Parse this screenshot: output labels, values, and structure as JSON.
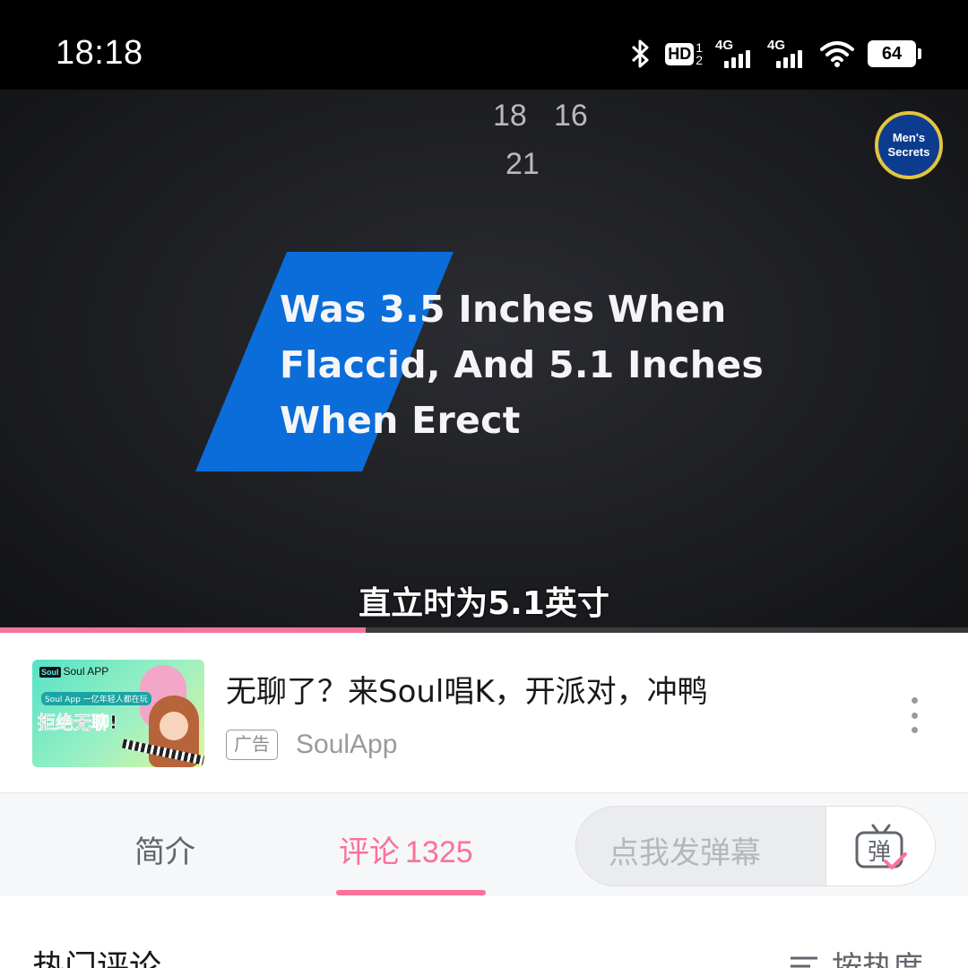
{
  "status_bar": {
    "time": "18:18",
    "hd_label": "HD",
    "hd_sub_top": "1",
    "hd_sub_bottom": "2",
    "sim1_label": "4G",
    "sim2_label": "4G",
    "battery_level": "64",
    "icons": [
      "bluetooth-icon",
      "hd-voice-icon",
      "signal-4g-icon",
      "signal-4g-icon",
      "wifi-icon",
      "battery-icon"
    ]
  },
  "video": {
    "danmaku": [
      "18",
      "16",
      "21"
    ],
    "channel_logo_line1": "Men's",
    "channel_logo_line2": "Secrets",
    "overlay_lines": [
      "Was 3.5 Inches When",
      "Flaccid, And 5.1 Inches",
      "When Erect"
    ],
    "subtitle": "直立时为5.1英寸",
    "progress": 0.378,
    "accent_color": "#fb7299",
    "banner_color": "#0a6dd9"
  },
  "ad": {
    "title": "无聊了？来Soul唱K，开派对，冲鸭",
    "label": "广告",
    "source": "SoulApp",
    "thumb_brand_icon": "Soul",
    "thumb_brand": "Soul APP",
    "thumb_tag": "Soul App 一亿年轻人都在玩",
    "thumb_main": "拒绝无聊!"
  },
  "tabs": {
    "intro": "简介",
    "comments": "评论",
    "comments_count": "1325",
    "danmaku_placeholder": "点我发弹幕",
    "danmaku_button": "弹"
  },
  "comments_section": {
    "title": "热门评论",
    "sort_label": "按热度"
  }
}
